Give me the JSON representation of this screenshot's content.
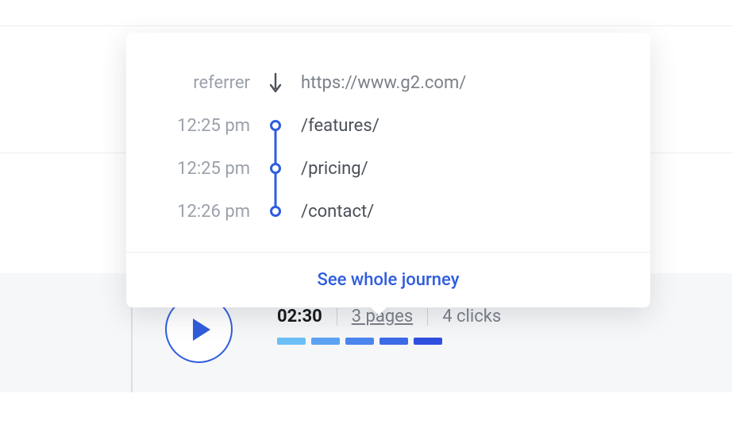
{
  "session": {
    "duration": "02:30",
    "pages_label": "3 pages",
    "clicks_label": "4 clicks"
  },
  "journey": {
    "referrer_label": "referrer",
    "referrer_url": "https://www.g2.com/",
    "steps": [
      {
        "time": "12:25 pm",
        "path": "/features/"
      },
      {
        "time": "12:25 pm",
        "path": "/pricing/"
      },
      {
        "time": "12:26 pm",
        "path": "/contact/"
      }
    ],
    "footer_link": "See whole journey"
  }
}
